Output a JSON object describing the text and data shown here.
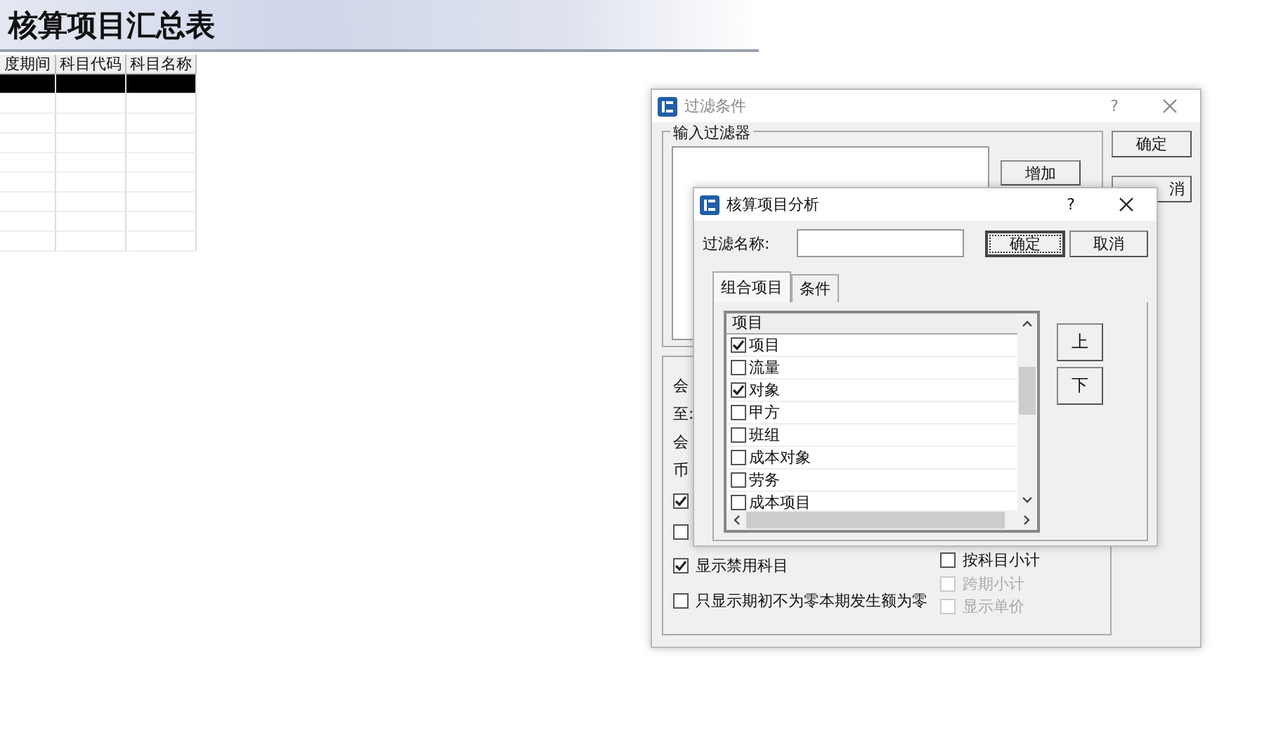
{
  "report": {
    "title": "核算项目汇总表",
    "columns": [
      "度期间",
      "科目代码",
      "科目名称"
    ],
    "rows": [
      {
        "selected": true
      },
      {
        "selected": false
      },
      {
        "selected": false
      },
      {
        "selected": false
      },
      {
        "selected": false
      },
      {
        "selected": false
      },
      {
        "selected": false
      },
      {
        "selected": false
      },
      {
        "selected": false
      }
    ]
  },
  "filter_dialog": {
    "title": "过滤条件",
    "help": "?",
    "filter_group": {
      "label": "输入过滤器",
      "add_button": "增加"
    },
    "buttons": [
      "确定",
      "消"
    ],
    "labels": [
      "会",
      "至:",
      "会",
      "币"
    ],
    "left_options": [
      {
        "checked": true
      },
      {
        "checked": false
      },
      {
        "label": "显示禁用科目",
        "checked": true
      },
      {
        "label": "只显示期初不为零本期发生额为零",
        "checked": false
      }
    ],
    "right_options": [
      {
        "label": "按科目小计",
        "checked": false,
        "disabled": false
      },
      {
        "label": "跨期小计",
        "checked": false,
        "disabled": true
      },
      {
        "label": "显示单价",
        "checked": false,
        "disabled": true
      }
    ]
  },
  "analysis_dialog": {
    "title": "核算项目分析",
    "help": "?",
    "filter_name": {
      "label": "过滤名称:"
    },
    "buttons": [
      {
        "label": "确定",
        "focused": true
      },
      {
        "label": "取消",
        "focused": false
      }
    ],
    "tabs": [
      {
        "label": "组合项目",
        "selected": true
      },
      {
        "label": "条件",
        "selected": false
      }
    ],
    "list": {
      "header": "项目",
      "items": [
        {
          "label": "项目",
          "checked": true
        },
        {
          "label": "流量",
          "checked": false
        },
        {
          "label": "对象",
          "checked": true
        },
        {
          "label": "甲方",
          "checked": false
        },
        {
          "label": "班组",
          "checked": false
        },
        {
          "label": "成本对象",
          "checked": false
        },
        {
          "label": "劳务",
          "checked": false
        },
        {
          "label": "成本项目",
          "checked": false
        }
      ]
    },
    "move_buttons": [
      "上",
      "下"
    ]
  }
}
